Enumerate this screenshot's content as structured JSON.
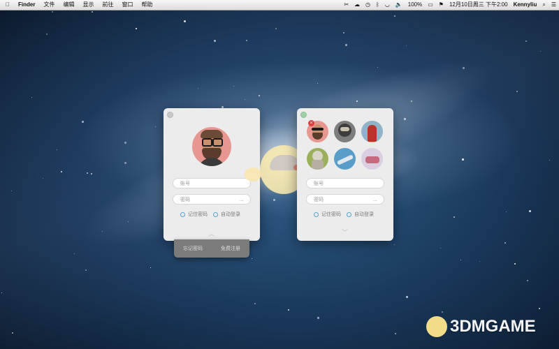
{
  "menubar": {
    "items": [
      "Finder",
      "文件",
      "编辑",
      "显示",
      "前往",
      "窗口",
      "帮助"
    ],
    "battery": "100%",
    "datetime": "12月10日周三 下午2:00",
    "user": "Kennyliu"
  },
  "login_panel": {
    "account_placeholder": "账号",
    "password_placeholder": "密码",
    "remember_password": "记住密码",
    "auto_login": "自动登录",
    "forgot_password": "忘记密码",
    "register": "免费注册"
  },
  "account_panel": {
    "account_placeholder": "账号",
    "password_placeholder": "密码",
    "remember_password": "记住密码",
    "auto_login": "自动登录"
  },
  "watermark": "3DMGAME",
  "colors": {
    "accent": "#5aa2d6",
    "close_red": "#e23d3d",
    "avatar_bg": "#e79790"
  }
}
